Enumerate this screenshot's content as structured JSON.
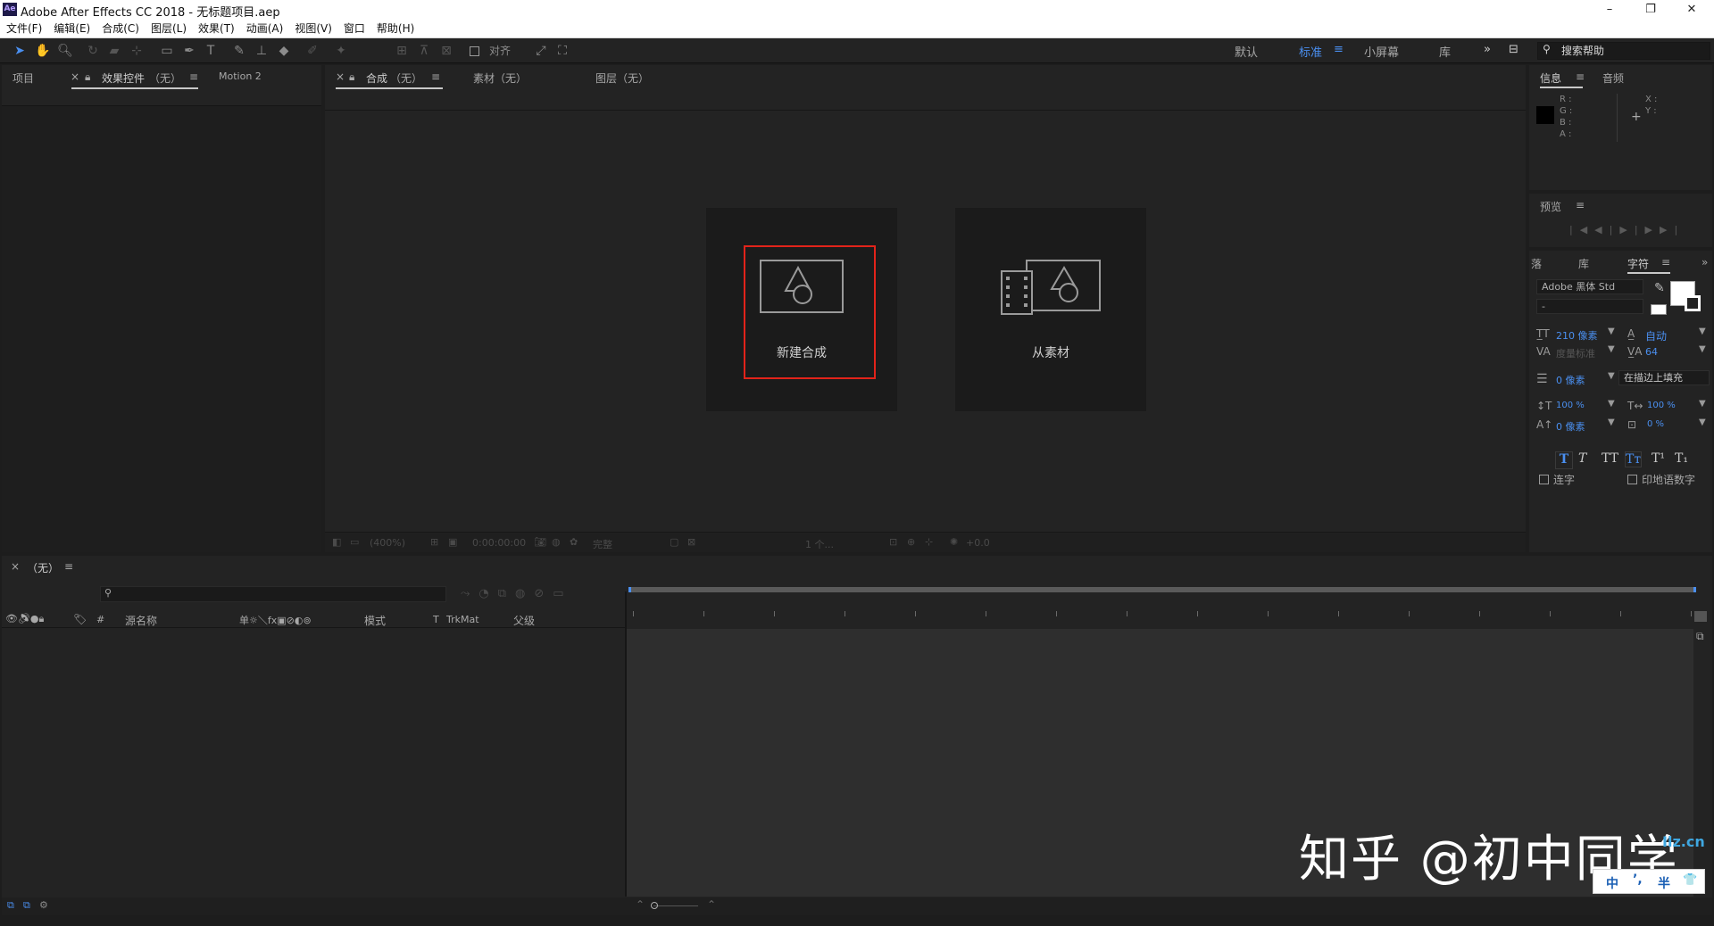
{
  "window": {
    "app_icon": "Ae",
    "title": "Adobe After Effects CC 2018 - 无标题项目.aep",
    "minimize": "–",
    "maximize": "❐",
    "close": "✕"
  },
  "menu": [
    "文件(F)",
    "编辑(E)",
    "合成(C)",
    "图层(L)",
    "效果(T)",
    "动画(A)",
    "视图(V)",
    "窗口",
    "帮助(H)"
  ],
  "toolbar": {
    "align_label": "对齐",
    "workspaces": [
      "默认",
      "标准",
      "小屏幕",
      "库"
    ],
    "active_workspace": "标准",
    "overflow": "»",
    "help_placeholder": "搜索帮助"
  },
  "left_panel": {
    "tabs": [
      "项目",
      "效果控件",
      "（无）",
      "Motion 2"
    ],
    "close_mark": "×",
    "menu_mark": "≡"
  },
  "comp_panel": {
    "tabs": [
      "合成",
      "（无）",
      "素材（无）",
      "图层（无）"
    ],
    "cards": [
      {
        "label": "新建合成"
      },
      {
        "label": "从素材"
      }
    ],
    "bottom_bar": {
      "zoom": "(400%)",
      "timecode": "0:00:00:00",
      "quality": "完整",
      "views": "1 个...",
      "exposure": "+0.0"
    }
  },
  "info_panel": {
    "tabs": [
      "信息",
      "音频"
    ],
    "channels": [
      "R :",
      "G :",
      "B :",
      "A :"
    ],
    "coords": [
      "X :",
      "Y :"
    ],
    "swatch_color": "#000000"
  },
  "preview_panel": {
    "title": "预览",
    "controls": [
      "|◀",
      "◀|",
      "▶",
      "|▶",
      "▶|"
    ]
  },
  "char_panel": {
    "tabs": [
      "落",
      "库",
      "字符"
    ],
    "font": "Adobe 黑体 Std",
    "style": "-",
    "size": "210 像素",
    "leading": "自动",
    "kerning": "度量标准",
    "tracking": "64",
    "stroke_width": "0 像素",
    "stroke_mode": "在描边上填充",
    "vscale": "100 %",
    "hscale": "100 %",
    "baseline": "0 像素",
    "tsume": "0 %",
    "formats": [
      "T",
      "T",
      "TT",
      "Tт",
      "T¹",
      "T₁"
    ],
    "ligature": "连字",
    "hindi": "印地语数字"
  },
  "timeline": {
    "tab": "（无）",
    "search_placeholder": "",
    "columns": {
      "source_name": "源名称",
      "switches": "单☼＼fx▣⊘◐⊚",
      "mode": "模式",
      "t": "T",
      "trkmat": "TrkMat",
      "parent": "父级",
      "num": "#"
    }
  },
  "watermark": {
    "text": "知乎 @初中同学",
    "ime": [
      "中",
      "’,",
      "半",
      "👕"
    ],
    "corner": "Ilz.cn"
  }
}
